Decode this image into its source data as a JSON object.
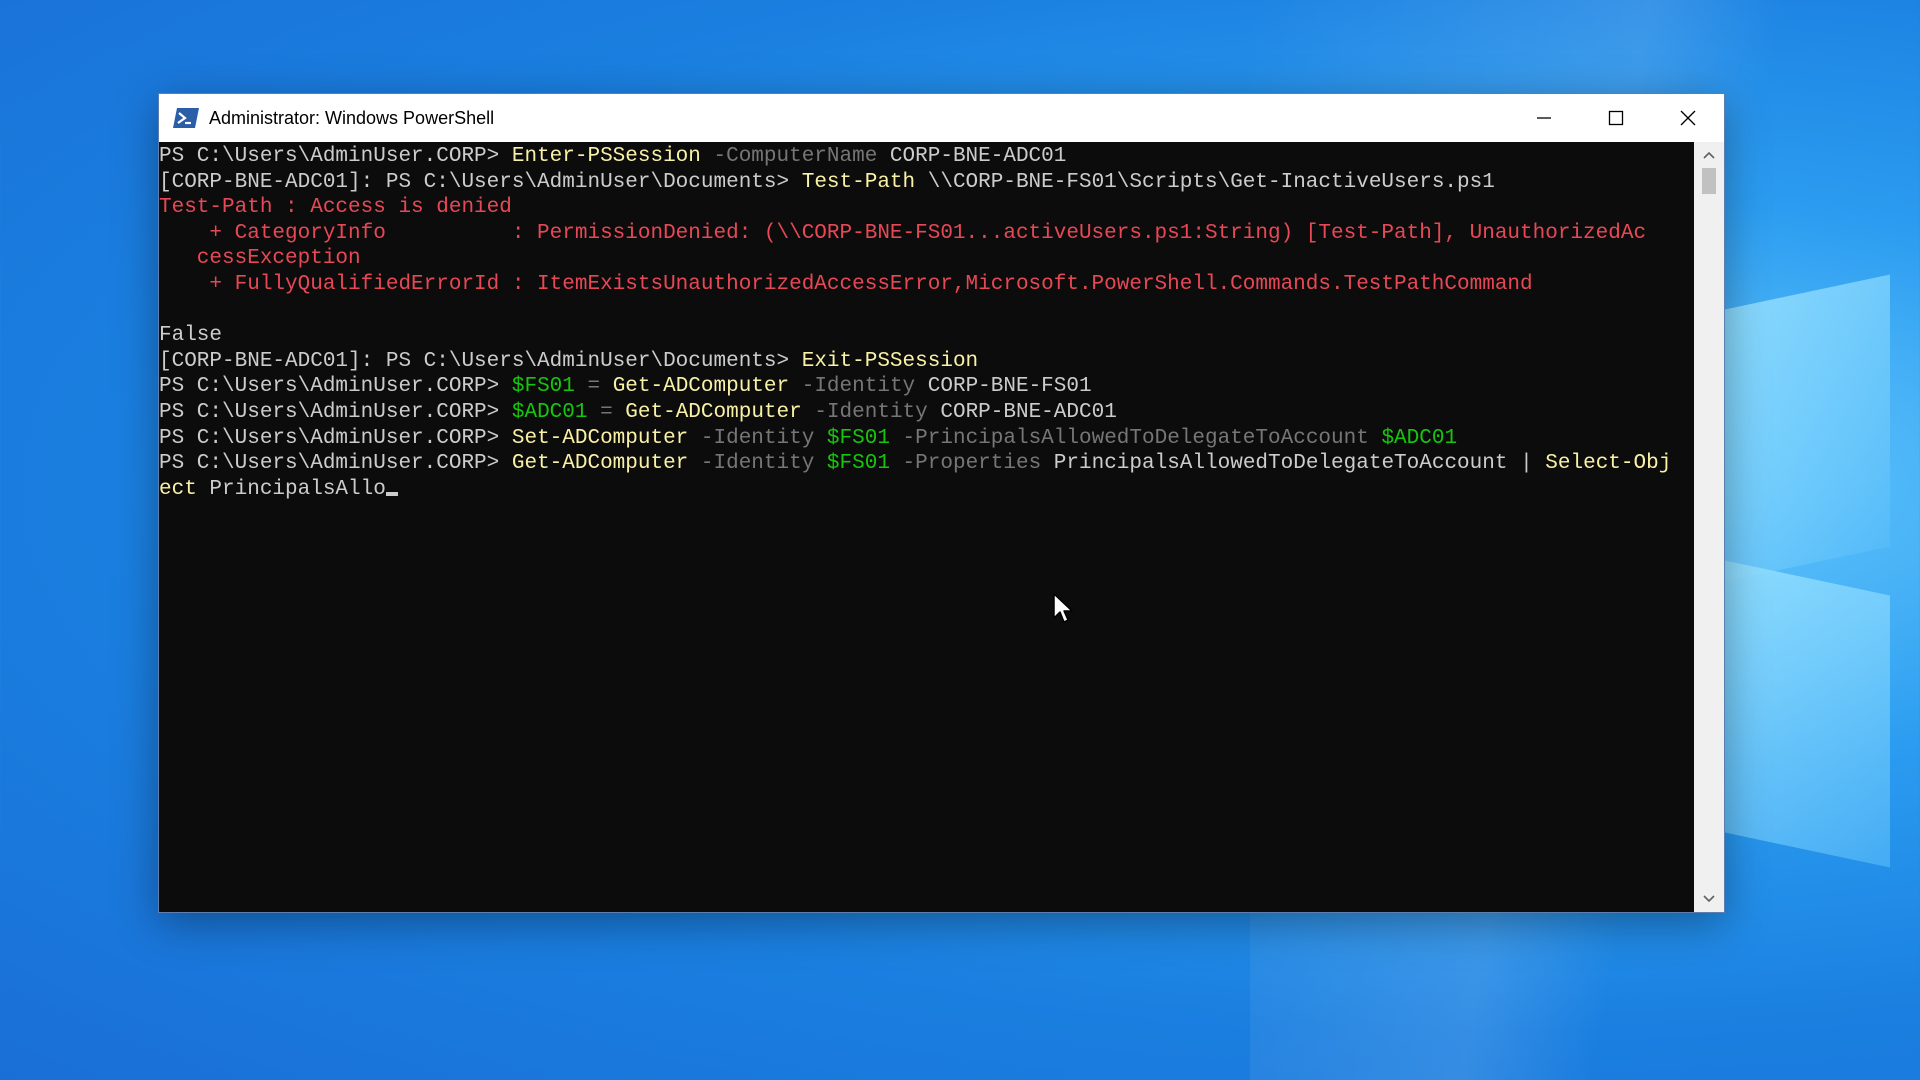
{
  "window": {
    "title": "Administrator: Windows PowerShell",
    "icon": "powershell-icon",
    "controls": [
      "minimize-icon",
      "maximize-icon",
      "close-icon"
    ]
  },
  "console": {
    "colors": {
      "background": "#0c0c0c",
      "text": "#cccccc",
      "command": "#f9f1a5",
      "parameter": "#767676",
      "variable": "#16c60c",
      "error": "#e74856"
    },
    "lines": [
      [
        {
          "t": "PS C:\\Users\\AdminUser.CORP> ",
          "c": "w"
        },
        {
          "t": "Enter-PSSession",
          "c": "cmd"
        },
        {
          "t": " -ComputerName",
          "c": "par"
        },
        {
          "t": " CORP-BNE-ADC01",
          "c": "w"
        }
      ],
      [
        {
          "t": "[CORP-BNE-ADC01]: PS C:\\Users\\AdminUser\\Documents> ",
          "c": "w"
        },
        {
          "t": "Test-Path",
          "c": "cmd"
        },
        {
          "t": " \\\\CORP-BNE-FS01\\Scripts\\Get-InactiveUsers.ps1",
          "c": "w"
        }
      ],
      [
        {
          "t": "Test-Path : Access is denied",
          "c": "err"
        }
      ],
      [
        {
          "t": "    + CategoryInfo          : PermissionDenied: (\\\\CORP-BNE-FS01...activeUsers.ps1:String) [Test-Path], UnauthorizedAc",
          "c": "err"
        }
      ],
      [
        {
          "t": "   cessException",
          "c": "err"
        }
      ],
      [
        {
          "t": "    + FullyQualifiedErrorId : ItemExistsUnauthorizedAccessError,Microsoft.PowerShell.Commands.TestPathCommand",
          "c": "err"
        }
      ],
      [
        {
          "t": "",
          "c": "w"
        }
      ],
      [
        {
          "t": "False",
          "c": "w"
        }
      ],
      [
        {
          "t": "[CORP-BNE-ADC01]: PS C:\\Users\\AdminUser\\Documents> ",
          "c": "w"
        },
        {
          "t": "Exit-PSSession",
          "c": "cmd"
        }
      ],
      [
        {
          "t": "PS C:\\Users\\AdminUser.CORP> ",
          "c": "w"
        },
        {
          "t": "$FS01",
          "c": "var"
        },
        {
          "t": " = ",
          "c": "op"
        },
        {
          "t": "Get-ADComputer",
          "c": "cmd"
        },
        {
          "t": " -Identity",
          "c": "par"
        },
        {
          "t": " CORP-BNE-FS01",
          "c": "w"
        }
      ],
      [
        {
          "t": "PS C:\\Users\\AdminUser.CORP> ",
          "c": "w"
        },
        {
          "t": "$ADC01",
          "c": "var"
        },
        {
          "t": " = ",
          "c": "op"
        },
        {
          "t": "Get-ADComputer",
          "c": "cmd"
        },
        {
          "t": " -Identity",
          "c": "par"
        },
        {
          "t": " CORP-BNE-ADC01",
          "c": "w"
        }
      ],
      [
        {
          "t": "PS C:\\Users\\AdminUser.CORP> ",
          "c": "w"
        },
        {
          "t": "Set-ADComputer",
          "c": "cmd"
        },
        {
          "t": " -Identity",
          "c": "par"
        },
        {
          "t": " $FS01",
          "c": "var"
        },
        {
          "t": " -PrincipalsAllowedToDelegateToAccount",
          "c": "par"
        },
        {
          "t": " $ADC01",
          "c": "var"
        }
      ],
      [
        {
          "t": "PS C:\\Users\\AdminUser.CORP> ",
          "c": "w"
        },
        {
          "t": "Get-ADComputer",
          "c": "cmd"
        },
        {
          "t": " -Identity",
          "c": "par"
        },
        {
          "t": " $FS01",
          "c": "var"
        },
        {
          "t": " -Properties",
          "c": "par"
        },
        {
          "t": " PrincipalsAllowedToDelegateToAccount | ",
          "c": "w"
        },
        {
          "t": "Select-Obj",
          "c": "cmd"
        }
      ],
      [
        {
          "t": "ect",
          "c": "cmd"
        },
        {
          "t": " PrincipalsAllo",
          "c": "w"
        }
      ]
    ]
  }
}
